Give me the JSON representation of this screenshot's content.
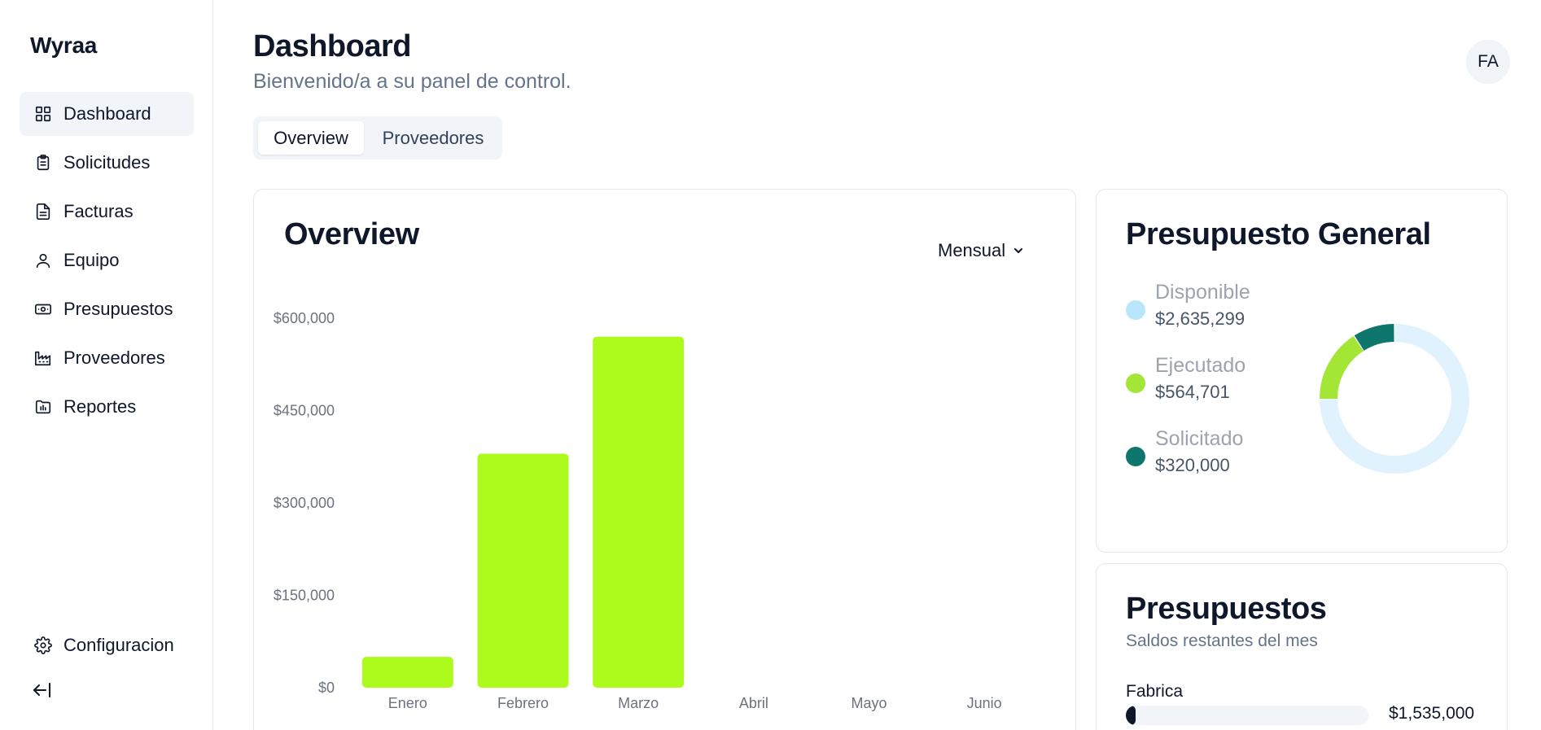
{
  "sidebar": {
    "brand": "Wyraa",
    "items": [
      {
        "label": "Dashboard",
        "icon": "grid-icon"
      },
      {
        "label": "Solicitudes",
        "icon": "clipboard-icon"
      },
      {
        "label": "Facturas",
        "icon": "file-text-icon"
      },
      {
        "label": "Equipo",
        "icon": "user-icon"
      },
      {
        "label": "Presupuestos",
        "icon": "banknote-icon"
      },
      {
        "label": "Proveedores",
        "icon": "factory-icon"
      },
      {
        "label": "Reportes",
        "icon": "folder-chart-icon"
      }
    ],
    "settings_label": "Configuracion",
    "collapse_icon": "collapse-sidebar-icon"
  },
  "header": {
    "title": "Dashboard",
    "subtitle": "Bienvenido/a a su panel de control.",
    "avatar_initials": "FA"
  },
  "tabs": [
    {
      "label": "Overview",
      "active": true
    },
    {
      "label": "Proveedores",
      "active": false
    }
  ],
  "overview": {
    "title": "Overview",
    "period": "Mensual"
  },
  "chart_data": {
    "type": "bar",
    "title": "Overview",
    "categories": [
      "Enero",
      "Febrero",
      "Marzo",
      "Abril",
      "Mayo",
      "Junio"
    ],
    "values": [
      50000,
      380000,
      570000,
      0,
      0,
      0
    ],
    "ylim": [
      0,
      600000
    ],
    "yticks": [
      0,
      150000,
      300000,
      450000,
      600000
    ],
    "ytick_labels": [
      "$0",
      "$150,000",
      "$300,000",
      "$450,000",
      "$600,000"
    ],
    "bar_color": "#adfa1d",
    "grid": false
  },
  "budget": {
    "title": "Presupuesto General",
    "items": [
      {
        "name": "Disponible",
        "value": "$2,635,299",
        "amount": 2635299,
        "color": "#bae6fd",
        "ring_color": "#e0f2fe"
      },
      {
        "name": "Ejecutado",
        "value": "$564,701",
        "amount": 564701,
        "color": "#a3e635",
        "ring_color": "#a3e635"
      },
      {
        "name": "Solicitado",
        "value": "$320,000",
        "amount": 320000,
        "color": "#0f766e",
        "ring_color": "#0f766e"
      }
    ]
  },
  "presupuestos": {
    "title": "Presupuestos",
    "subtitle": "Saldos restantes del mes",
    "rows": [
      {
        "label": "Fabrica",
        "amount": "$1,535,000",
        "progress": 0.04
      }
    ]
  }
}
